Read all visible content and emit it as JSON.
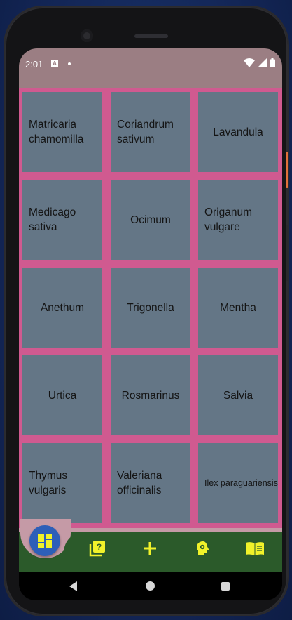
{
  "status_bar": {
    "time": "2:01"
  },
  "grid": {
    "tiles": [
      {
        "label": "Matricaria chamomilla"
      },
      {
        "label": "Coriandrum sativum"
      },
      {
        "label": "Lavandula"
      },
      {
        "label": "Medicago sativa"
      },
      {
        "label": "Ocimum"
      },
      {
        "label": "Origanum vulgare"
      },
      {
        "label": "Anethum"
      },
      {
        "label": "Trigonella"
      },
      {
        "label": "Mentha"
      },
      {
        "label": "Urtica"
      },
      {
        "label": "Rosmarinus"
      },
      {
        "label": "Salvia"
      },
      {
        "label": "Thymus vulgaris"
      },
      {
        "label": "Valeriana officinalis"
      },
      {
        "label": "Ilex paraguariensis"
      }
    ]
  },
  "bottom_nav": {
    "items": [
      {
        "icon": "dashboard-icon"
      },
      {
        "icon": "quiz-icon"
      },
      {
        "icon": "add-icon"
      },
      {
        "icon": "brain-gear-icon"
      },
      {
        "icon": "book-icon"
      }
    ]
  },
  "colors": {
    "grid_border": "#d05a90",
    "tile": "#647686",
    "status_bar": "#9b7e83",
    "bottom_bar": "#2b5a2a",
    "fab": "#2d5fb8",
    "nav_icon": "#f1f22a"
  }
}
